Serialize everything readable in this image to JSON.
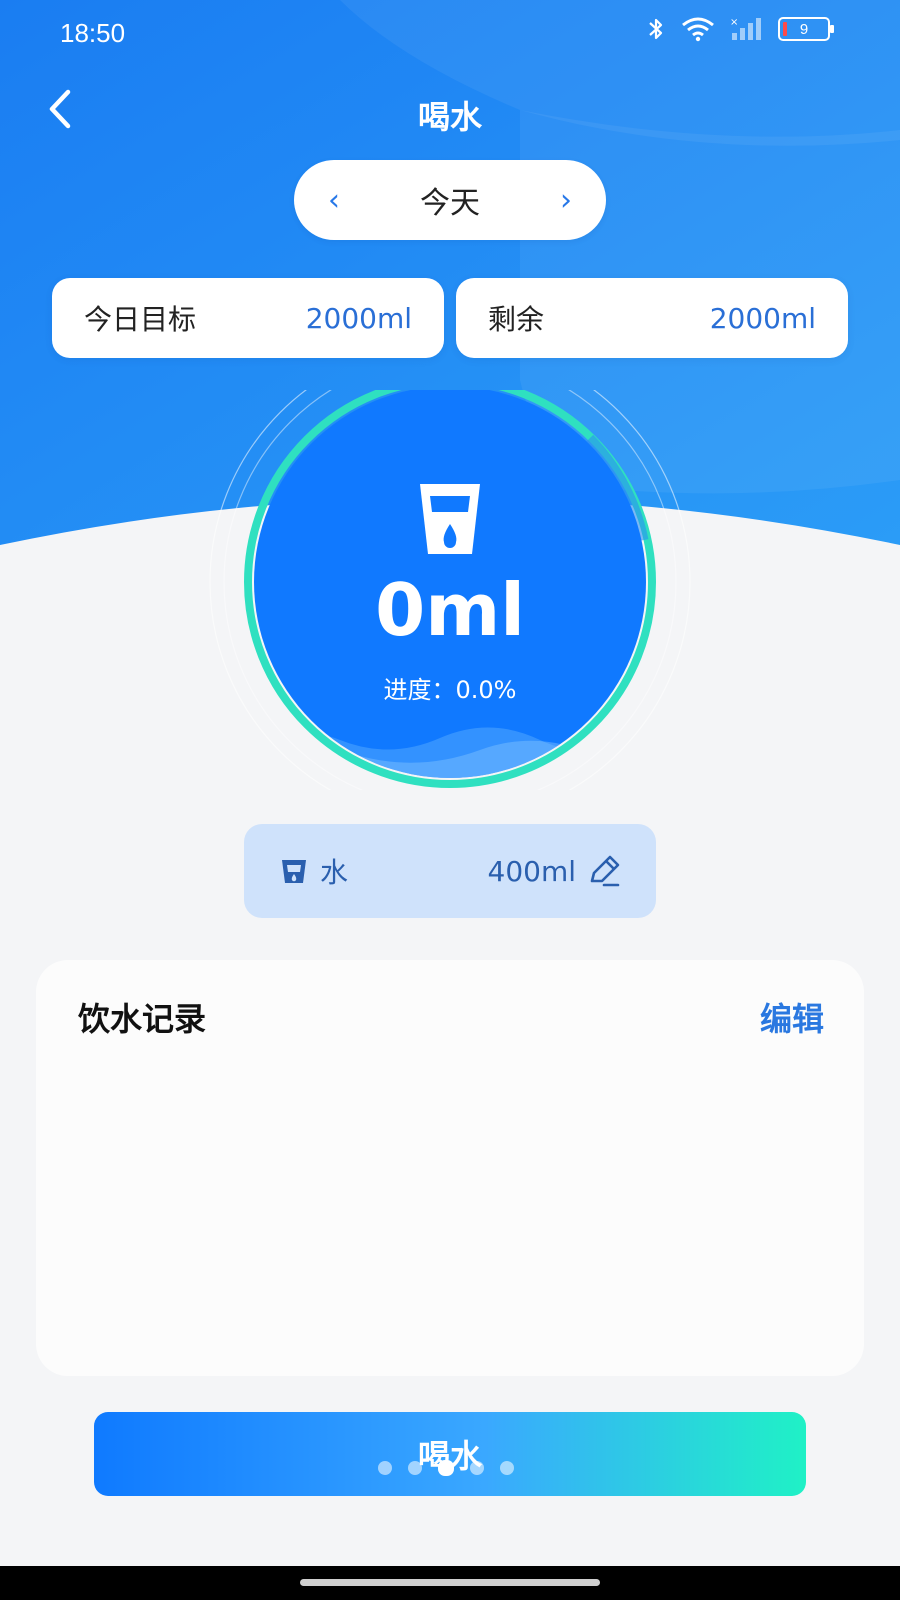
{
  "status_bar": {
    "time": "18:50",
    "battery": "9",
    "icons": [
      "bluetooth-icon",
      "wifi-icon",
      "signal-icon",
      "battery-icon"
    ]
  },
  "nav": {
    "title": "喝水",
    "back_icon": "chevron-left-icon"
  },
  "date_selector": {
    "prev": "‹",
    "label": "今天",
    "next": "›"
  },
  "stats": {
    "goal_label": "今日目标",
    "goal_value": "2000ml",
    "remaining_label": "剩余",
    "remaining_value": "2000ml"
  },
  "gauge": {
    "amount": "0ml",
    "progress_text": "进度：0.0%",
    "progress_fraction": 0.0,
    "icon": "water-cup-icon"
  },
  "drink_chip": {
    "name": "水",
    "amount": "400ml",
    "icon": "cup-icon",
    "edit_icon": "pencil-icon"
  },
  "records": {
    "title": "饮水记录",
    "edit_label": "编辑"
  },
  "drink_button": {
    "label": "喝水"
  },
  "page_indicator": {
    "count": 5,
    "active_index": 2
  },
  "colors": {
    "primary": "#0f7aff",
    "accent": "#1ff1c6",
    "chip_bg": "#cfe2fb",
    "link": "#2a78e0"
  }
}
